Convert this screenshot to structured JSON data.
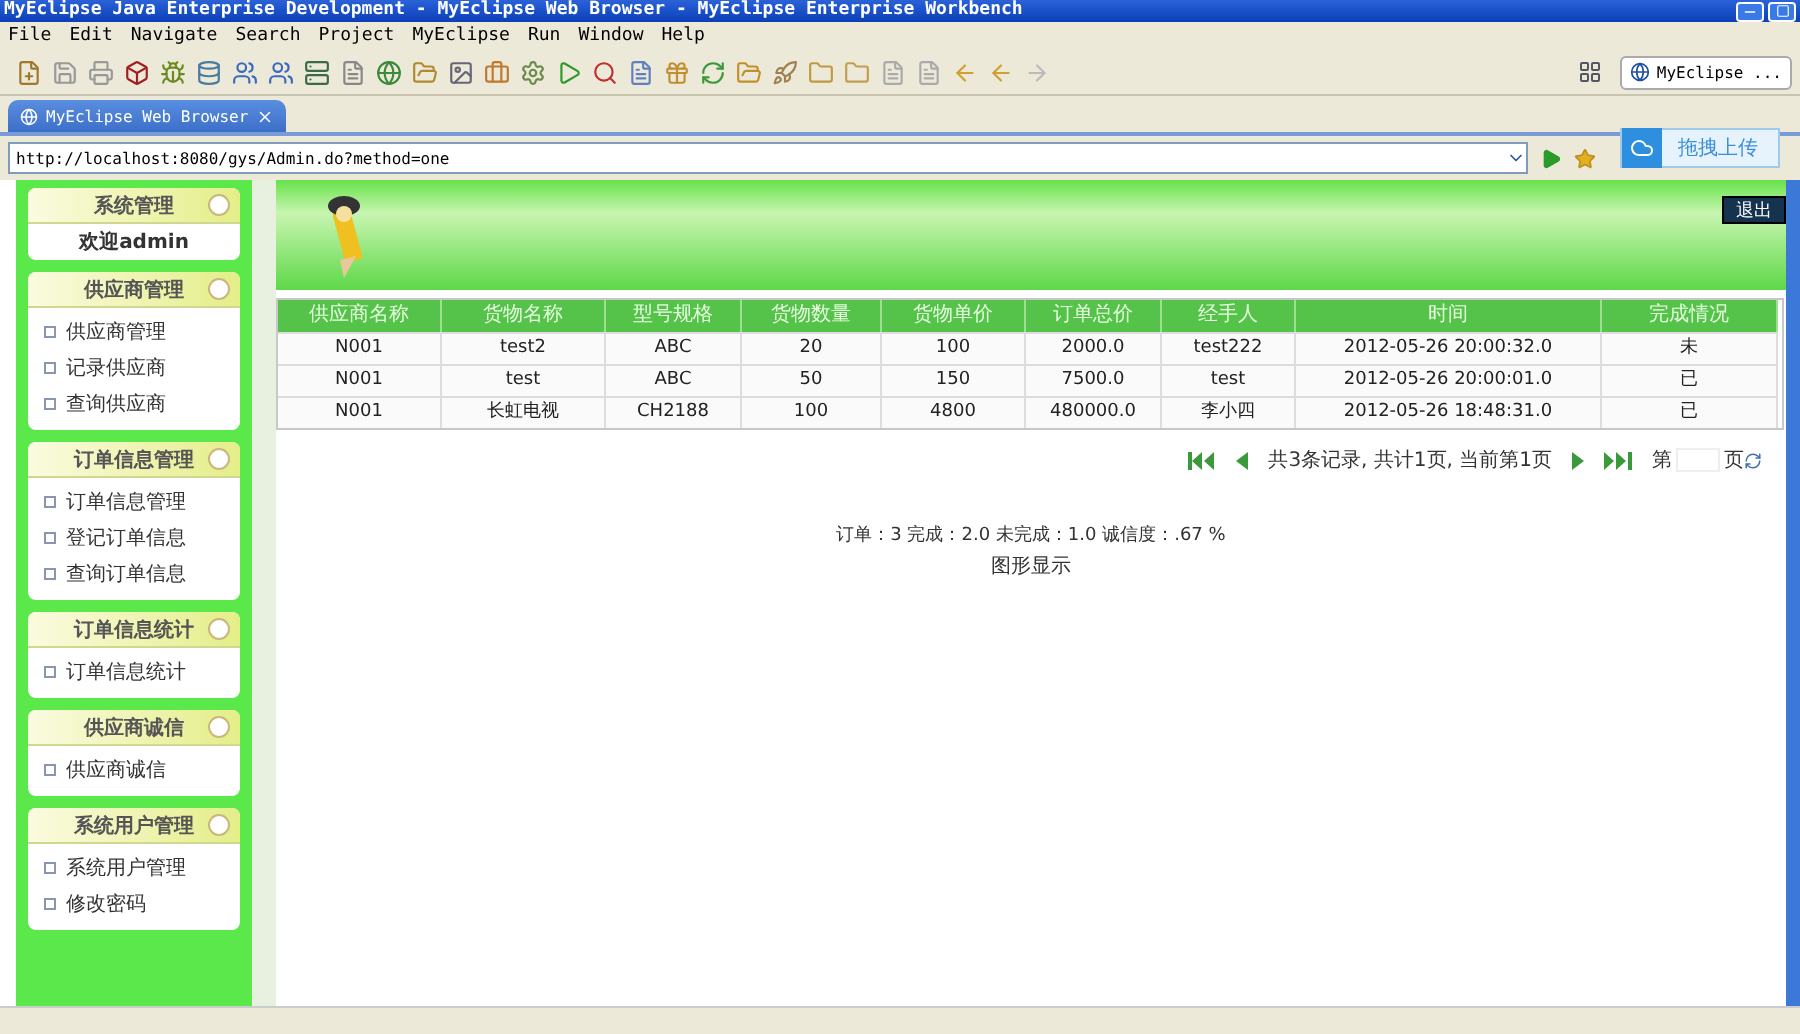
{
  "window": {
    "title": "MyEclipse Java Enterprise Development - MyEclipse Web Browser - MyEclipse Enterprise Workbench"
  },
  "menu": [
    "File",
    "Edit",
    "Navigate",
    "Search",
    "Project",
    "MyEclipse",
    "Run",
    "Window",
    "Help"
  ],
  "perspective": "MyEclipse ...",
  "editor_tabs": [
    {
      "label": "MyEclipse Web Browser",
      "selected": true
    }
  ],
  "address": "http://localhost:8080/gys/Admin.do?method=one",
  "upload_button": "拖拽上传",
  "sidebar": [
    {
      "title": "系统管理",
      "kind": "welcome",
      "items": [
        "欢迎admin"
      ]
    },
    {
      "title": "供应商管理",
      "kind": "links",
      "items": [
        "供应商管理",
        "记录供应商",
        "查询供应商"
      ]
    },
    {
      "title": "订单信息管理",
      "kind": "links",
      "items": [
        "订单信息管理",
        "登记订单信息",
        "查询订单信息"
      ]
    },
    {
      "title": "订单信息统计",
      "kind": "links",
      "items": [
        "订单信息统计"
      ]
    },
    {
      "title": "供应商诚信",
      "kind": "links",
      "items": [
        "供应商诚信"
      ]
    },
    {
      "title": "系统用户管理",
      "kind": "links",
      "items": [
        "系统用户管理",
        "修改密码"
      ]
    }
  ],
  "logout": "退出",
  "table": {
    "columns": [
      "供应商名称",
      "货物名称",
      "型号规格",
      "货物数量",
      "货物单价",
      "订单总价",
      "经手人",
      "时间",
      "完成情况"
    ],
    "rows": [
      [
        "N001",
        "test2",
        "ABC",
        "20",
        "100",
        "2000.0",
        "test222",
        "2012-05-26 20:00:32.0",
        "未"
      ],
      [
        "N001",
        "test",
        "ABC",
        "50",
        "150",
        "7500.0",
        "test",
        "2012-05-26 20:00:01.0",
        "已"
      ],
      [
        "N001",
        "长虹电视",
        "CH2188",
        "100",
        "4800",
        "480000.0",
        "李小四",
        "2012-05-26 18:48:31.0",
        "已"
      ]
    ]
  },
  "pagination": {
    "summary": "共3条记录, 共计1页, 当前第1页",
    "page_prefix": "第",
    "page_suffix": "页"
  },
  "stats": "订单：3 完成：2.0 未完成：1.0 诚信度：.67 %",
  "chart_link": "图形显示"
}
